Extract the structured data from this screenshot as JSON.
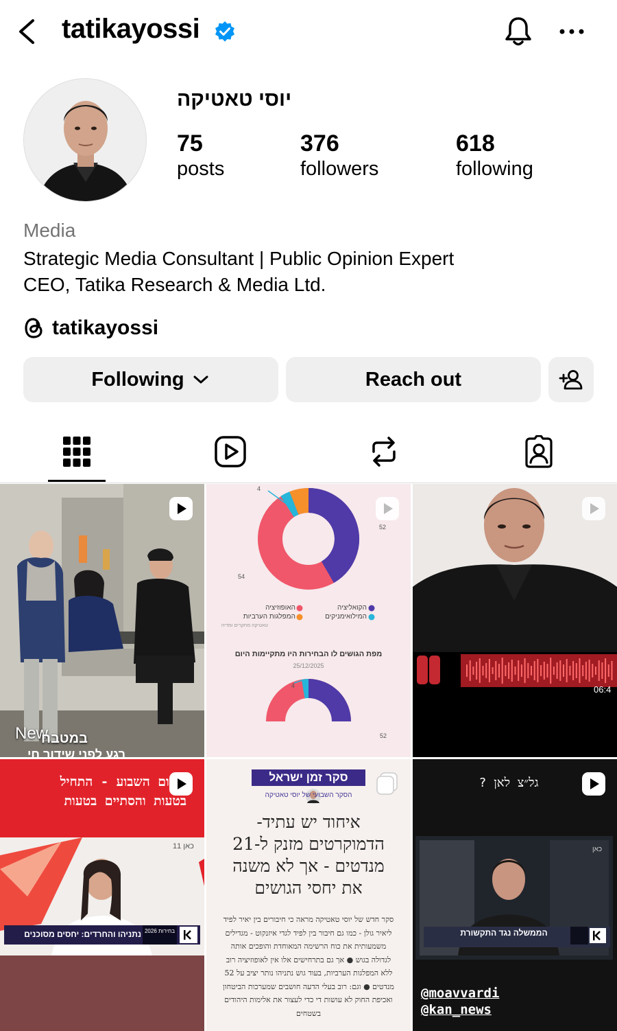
{
  "header": {
    "username": "tatikayossi",
    "back_icon": "chevron-left-icon",
    "verified_icon": "verified-badge-icon",
    "bell_icon": "bell-icon",
    "more_icon": "more-horizontal-icon",
    "verified_color": "#0095f6"
  },
  "profile": {
    "display_name": "יוסי טאטיקה",
    "stats": [
      {
        "value": "75",
        "label": "posts"
      },
      {
        "value": "376",
        "label": "followers"
      },
      {
        "value": "618",
        "label": "following"
      }
    ],
    "category": "Media",
    "bio_lines": [
      "Strategic Media Consultant | Public Opinion Expert",
      "CEO, Tatika Research & Media Ltd."
    ],
    "threads_handle": "tatikayossi"
  },
  "actions": {
    "following_label": "Following",
    "reach_out_label": "Reach out"
  },
  "tabs": [
    {
      "icon": "grid-icon",
      "selected": true
    },
    {
      "icon": "reels-icon",
      "selected": false
    },
    {
      "icon": "reposts-icon",
      "selected": false
    },
    {
      "icon": "tagged-icon",
      "selected": false
    }
  ],
  "posts": {
    "p1": {
      "badge": "New",
      "caption": "במטבח",
      "overlay": "רגע לפני שידור חי"
    },
    "p2": {
      "title": "מפת הגושים לו הבחירות היו מתקיימות היום",
      "date": "25/12/2025",
      "legend": [
        "הקואליציה",
        "האופוזיציה",
        "המילואימניקים",
        "המפלגות הערביות"
      ],
      "source": "טאטיקה מחקרים ומדיה",
      "values": {
        "top": "4",
        "right": "52",
        "left": "54",
        "lower_top": "4",
        "lower_right": "52"
      },
      "colors": {
        "coalition": "#4f3aa8",
        "opposition": "#f0576a",
        "reservists": "#27b5d9",
        "arab": "#f6902a"
      }
    },
    "p3": {
      "timer": "06:4"
    },
    "p4": {
      "headline_line1": "סיכום השבוע - התחיל",
      "headline_line2": "בטעות והסתיים בטעות",
      "channel": "כאן 11",
      "ticker": "נתניהו והחרדים: יחסים מסוכנים",
      "badge": "בחירות 2026"
    },
    "p5": {
      "banner": "סקר זמן ישראל",
      "subtitle": "הסקר השבועי של יוסי טאטיקה",
      "headline": [
        "איחוד יש עתיד-",
        "הדמוקרטים מזנק ל-21",
        "מנדטים - אך לא משנה",
        "את יחסי הגושים"
      ],
      "body": [
        "סקר חדש של יוסי טאטיקה מראה כי חיבורים בין יאיר לפיד",
        "ליאיר גולן - כמו גם חיבור בין לפיד לגדי איזנקוט - מגדילים",
        "משמעותית את כוח הרשימה המאוחדת והופכים אותה",
        "לגדולה בגוש ● אך גם בתרחישים אלו אין לאופוזיציה רוב",
        "ללא המפלגות הערביות, בעוד גוש נתניהו נותר יציב על 52",
        "מנדטים ● וגם: רוב בעלי הדעה חושבים שמערכות הביטחון",
        "ואכיפת החוק לא עושות די כדי לעצור את אלימות היהודים",
        "בשטחים"
      ]
    },
    "p6": {
      "question": "גל״צ לאן ?",
      "channel": "כאן",
      "ticker": "הממשלה נגד התקשורת",
      "mentions": [
        "@moavvardi",
        "@kan_news"
      ]
    }
  }
}
